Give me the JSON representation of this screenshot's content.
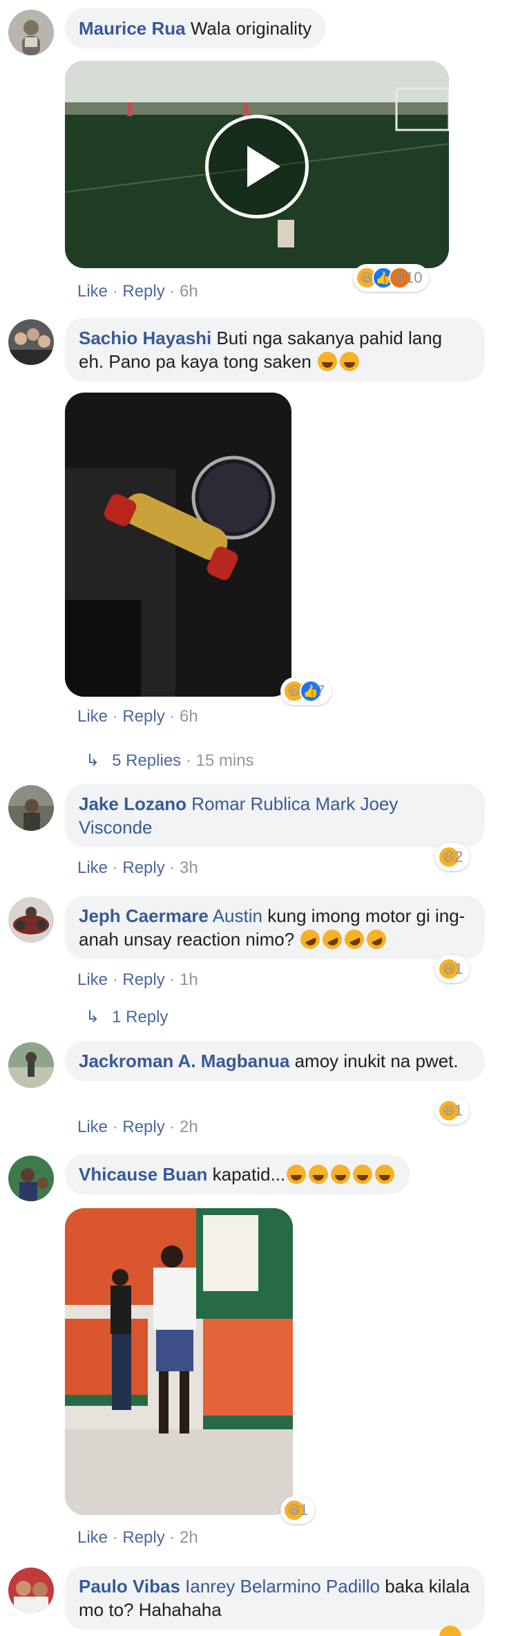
{
  "comments": [
    {
      "author": "Maurice Rua",
      "text": "Wala originality",
      "actions": {
        "like": "Like",
        "reply": "Reply",
        "time": "6h"
      },
      "reactions": {
        "types": [
          "haha",
          "like",
          "angry"
        ],
        "count": "10"
      }
    },
    {
      "author": "Sachio Hayashi",
      "text": "Buti nga sakanya pahid lang eh. Pano pa kaya tong saken",
      "actions": {
        "like": "Like",
        "reply": "Reply",
        "time": "6h"
      },
      "reactions": {
        "types": [
          "haha",
          "like"
        ],
        "count": "7"
      },
      "replies": {
        "label": "5 Replies",
        "time": "15 mins"
      }
    },
    {
      "author": "Jake Lozano",
      "mention": "Romar Rublica Mark Joey Visconde",
      "actions": {
        "like": "Like",
        "reply": "Reply",
        "time": "3h"
      },
      "reactions": {
        "types": [
          "haha"
        ],
        "count": "2"
      }
    },
    {
      "author": "Jeph Caermare",
      "mention": "Austin",
      "text": "kung imong motor gi ing-anah unsay reaction nimo?",
      "actions": {
        "like": "Like",
        "reply": "Reply",
        "time": "1h"
      },
      "reactions": {
        "types": [
          "haha"
        ],
        "count": "1"
      },
      "replies": {
        "label": "1 Reply",
        "time": ""
      }
    },
    {
      "author": "Jackroman A. Magbanua",
      "text": "amoy inukit na pwet.",
      "actions": {
        "like": "Like",
        "reply": "Reply",
        "time": "2h"
      },
      "reactions": {
        "types": [
          "haha"
        ],
        "count": "1"
      }
    },
    {
      "author": "Vhicause Buan",
      "text": "kapatid...",
      "actions": {
        "like": "Like",
        "reply": "Reply",
        "time": "2h"
      },
      "reactions": {
        "types": [
          "haha"
        ],
        "count": "1"
      }
    },
    {
      "author": "Paulo Vibas",
      "mention": "Ianrey Belarmino Padillo",
      "text": "baka kilala mo to? Hahahaha"
    }
  ],
  "separator": " · ",
  "reply_arrow": "↳",
  "colors": {
    "name": "#385898",
    "link": "#4b67a1",
    "meta": "#90949c",
    "bubble": "#f2f3f5",
    "haha": "#f7b125",
    "like": "#1877f2",
    "angry": "#e9710f"
  }
}
